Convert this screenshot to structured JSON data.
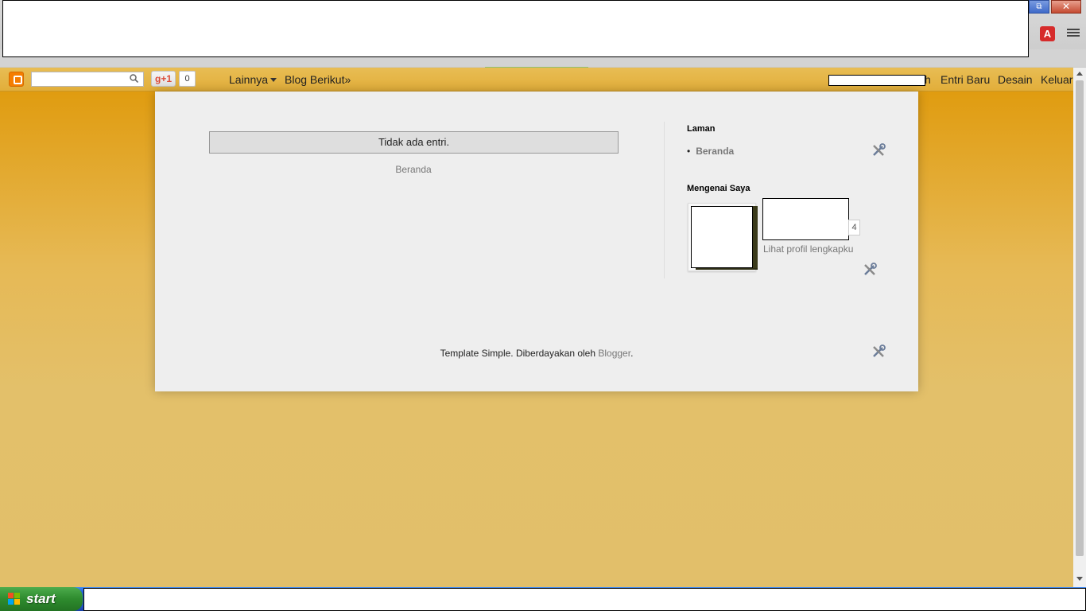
{
  "browser": {
    "restore_icon": "restore-window-icon",
    "close_symbol": "✕",
    "restore_symbol": "⧉"
  },
  "navbar": {
    "gplus_label": "g+1",
    "gplus_count": "0",
    "more_label": "Lainnya",
    "next_blog_label": "Blog Berikut»",
    "user_tail": "h",
    "new_post_label": "Entri Baru",
    "design_label": "Desain",
    "logout_label": "Keluar"
  },
  "main": {
    "no_posts_text": "Tidak ada entri.",
    "home_link": "Beranda"
  },
  "sidebar": {
    "pages_title": "Laman",
    "pages_items": [
      "Beranda"
    ],
    "about_title": "Mengenai Saya",
    "profile_count": "4",
    "profile_link": "Lihat profil lengkapku"
  },
  "footer": {
    "text": "Template Simple. Diberdayakan oleh ",
    "link": "Blogger",
    "end": "."
  },
  "taskbar": {
    "start_label": "start"
  },
  "colors": {
    "navbar": "#e6b647",
    "content_bg": "#eeeeee",
    "taskbar": "#245edb",
    "start_green": "#2e8b2e"
  }
}
